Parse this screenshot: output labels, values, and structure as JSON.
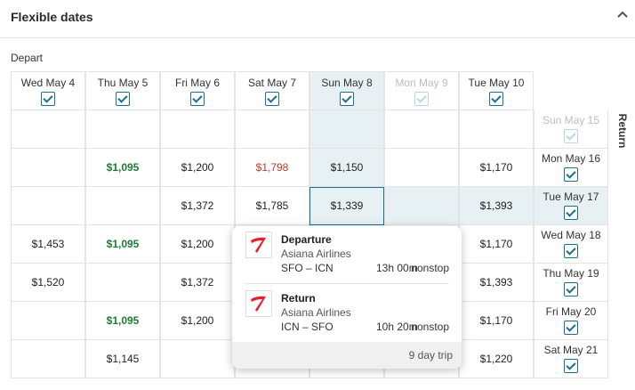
{
  "panel": {
    "title": "Flexible dates",
    "collapse_icon": "chevron-up-icon"
  },
  "depart_label": "Depart",
  "return_label": "Return",
  "columns": [
    {
      "label": "Wed May 4",
      "checked": true,
      "dimmed": false,
      "selected": false
    },
    {
      "label": "Thu May 5",
      "checked": true,
      "dimmed": false,
      "selected": false
    },
    {
      "label": "Fri May 6",
      "checked": true,
      "dimmed": false,
      "selected": false
    },
    {
      "label": "Sat May 7",
      "checked": true,
      "dimmed": false,
      "selected": false
    },
    {
      "label": "Sun May 8",
      "checked": true,
      "dimmed": false,
      "selected": true
    },
    {
      "label": "Mon May 9",
      "checked": true,
      "dimmed": true,
      "selected": false
    },
    {
      "label": "Tue May 10",
      "checked": true,
      "dimmed": false,
      "selected": false
    }
  ],
  "rows": [
    {
      "return_label": "Sun May 15",
      "dimmed": true,
      "selected": false,
      "prices": [
        "",
        "",
        "",
        "",
        "",
        "",
        ""
      ]
    },
    {
      "return_label": "Mon May 16",
      "dimmed": false,
      "selected": false,
      "prices": [
        "",
        "$1,095",
        "$1,200",
        "$1,798",
        "$1,150",
        "",
        "$1,170"
      ]
    },
    {
      "return_label": "Tue May 17",
      "dimmed": false,
      "selected": true,
      "prices": [
        "",
        "",
        "$1,372",
        "$1,785",
        "$1,339",
        "",
        "$1,393"
      ]
    },
    {
      "return_label": "Wed May 18",
      "dimmed": false,
      "selected": false,
      "prices": [
        "$1,453",
        "$1,095",
        "$1,200",
        "",
        "",
        "",
        "$1,170"
      ]
    },
    {
      "return_label": "Thu May 19",
      "dimmed": false,
      "selected": false,
      "prices": [
        "$1,520",
        "",
        "$1,372",
        "",
        "",
        "",
        "$1,393"
      ]
    },
    {
      "return_label": "Fri May 20",
      "dimmed": false,
      "selected": false,
      "prices": [
        "",
        "$1,095",
        "$1,200",
        "",
        "",
        "",
        "$1,170"
      ]
    },
    {
      "return_label": "Sat May 21",
      "dimmed": false,
      "selected": false,
      "prices": [
        "",
        "$1,145",
        "",
        "",
        "",
        "",
        "$1,220"
      ]
    }
  ],
  "price_styles": {
    "cheapest_color": "#1e7b35",
    "expensive_color": "#c0392b",
    "cheapest": [
      "$1,095"
    ],
    "expensive": [
      "$1,798"
    ]
  },
  "selected_cell": {
    "row": 2,
    "col": 4
  },
  "popup": {
    "departure": {
      "title": "Departure",
      "airline": "Asiana Airlines",
      "route": "SFO – ICN",
      "duration": "13h 00m",
      "stops": "nonstop",
      "logo_icon": "asiana-logo-icon"
    },
    "return": {
      "title": "Return",
      "airline": "Asiana Airlines",
      "route": "ICN – SFO",
      "duration": "10h 20m",
      "stops": "nonstop",
      "logo_icon": "asiana-logo-icon"
    },
    "trip_length": "9 day trip"
  },
  "colors": {
    "accent": "#1b6f8f",
    "selected_tint": "#e7f1f3"
  }
}
